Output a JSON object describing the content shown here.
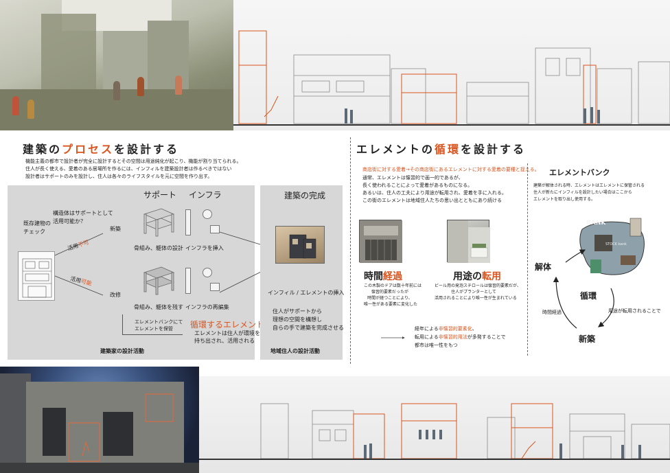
{
  "left": {
    "heading_pre": "建築の",
    "heading_accent": "プロセス",
    "heading_post": "を設計する",
    "intro": [
      "機能主義の都市で設計者が完全に設計するとその空間は用途純化が起こり、機能が割り当てられる。",
      "住人が長く使える、愛着のある居場所を作るには、インフィルを建築設計者は作るべきではない",
      "設計者はサポートのみを設計し、住人は各々のライフスタイルを元に空間を作り出す。"
    ],
    "support_label": "サポート",
    "infra_label": "インフラ",
    "structure_q1": "構造体はサポートとして",
    "structure_q2": "活用可能か？",
    "check1": "既存建物の",
    "check2": "チェック",
    "no_pre": "活用",
    "no_accent": "不可",
    "yes_pre": "活用",
    "yes_accent": "可能",
    "new_build": "新築",
    "renovate": "改修",
    "frame_design": "骨組み、躯体の設計",
    "infra_insert": "インフラを挿入",
    "frame_keep": "骨組み、躯体を残す",
    "infra_reedit": "インフラの再編集",
    "bank_note1": "エレメントバンクにて",
    "bank_note2": "エレメントを保管",
    "cycle_element": "循環するエレメント",
    "cycle_desc1": "エレメントは住人が環境を作り出す時に",
    "cycle_desc2": "持ち出され、活用される",
    "designer_activity": "建築家の設計活動",
    "complete_title": "建築の完成",
    "infill_insert": "インフィル / エレメントの挿入",
    "resident1": "住人がサポートから",
    "resident2": "理想の空間を構想し",
    "resident3": "自らの手で建築を完成させる",
    "resident_activity": "地域住人の設計活動"
  },
  "right": {
    "heading_pre": "エレメントの",
    "heading_accent": "循環",
    "heading_post": "を設計する",
    "intro_accent": "商店街に対する愛着→その商店街にあるエレメントに対する愛着の要種と捉える。",
    "intro": [
      "通常、エレメントは懐習的で画一的であるが、",
      "長く使われることによって愛着があるものになる。",
      "あるいは、住人の工夫により用途が転用され、愛着を手に入れる。",
      "この街のエレメントは地域住人たちの思い出とともにあり続ける"
    ],
    "time_pre": "時間",
    "time_accent": "経過",
    "time_desc": [
      "この木製のドアは数十年前には",
      "懐習的要素だったが",
      "時間が経つことにより、",
      "唯一性がある要素に変化した"
    ],
    "use_pre": "用途の",
    "use_accent": "転用",
    "use_desc": [
      "ビール用の発泡スチロールは懐習的要素だが、",
      "住人がプランターとして",
      "活用されることにより唯一性が生まれている"
    ],
    "summary1_pre": "経年による",
    "summary1_accent": "非懐習的要素化",
    "summary1_post": "、",
    "summary2_pre": "転用による",
    "summary2_accent": "非懐習的用法",
    "summary2_post": "が多発することで",
    "summary3": "都市は唯一性をもつ",
    "bank_title": "エレメントバンク",
    "bank_desc": [
      "建築が解体される時、エレメントはエレメントに保管される",
      "住人が新たにインフィルを設計したい場合はここから",
      "エレメントを取り出し使用する。"
    ],
    "bank_sign": "BANK",
    "stock_sign": "STOCK bank",
    "cycle_dismantle": "解体",
    "cycle_circulate": "循環",
    "cycle_new": "新築",
    "cycle_time": "時間経過",
    "cycle_use": "用途が転用されることで"
  },
  "colors": {
    "accent": "#d9541e",
    "panel": "#d7d7d7"
  }
}
